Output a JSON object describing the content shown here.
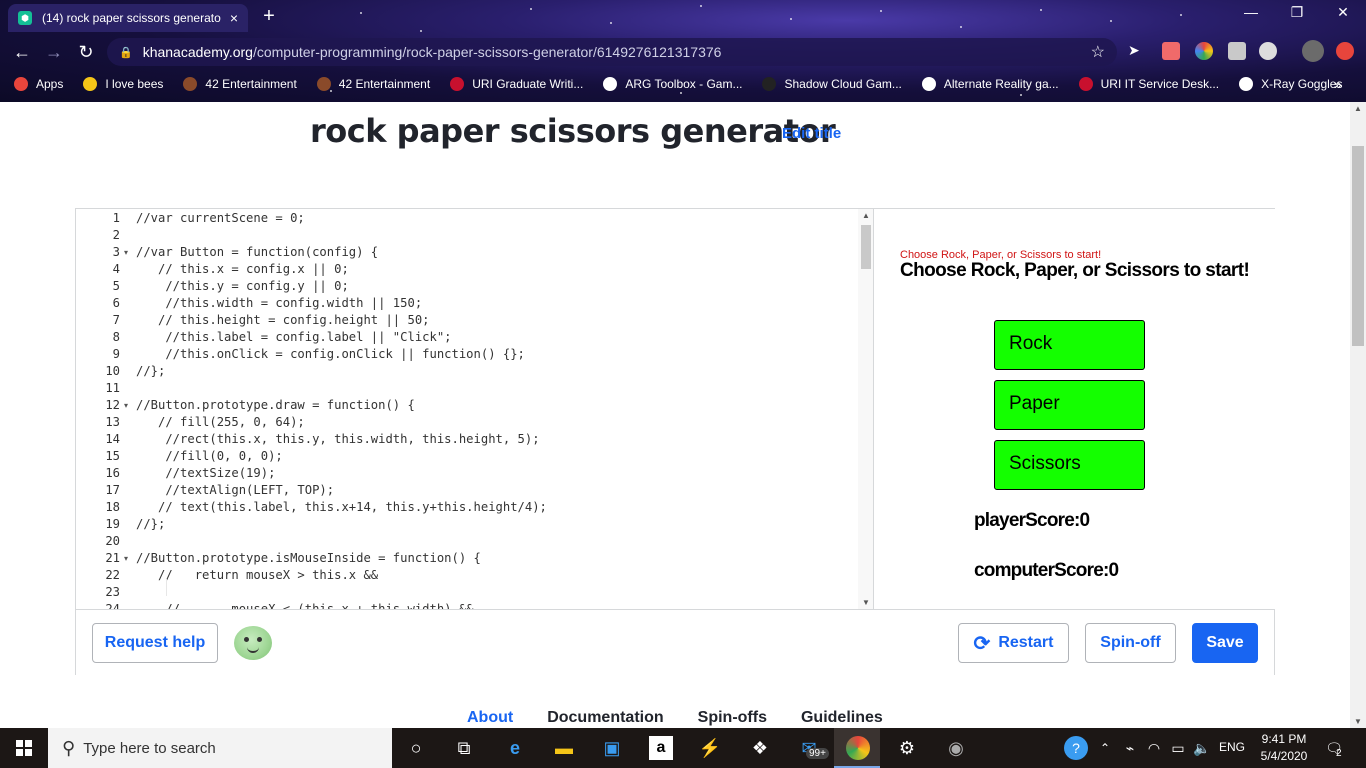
{
  "browser": {
    "tab_title": "(14) rock paper scissors generato",
    "tab_close": "×",
    "new_tab": "+",
    "url_host": "khanacademy.org",
    "url_path": "/computer-programming/rock-paper-scissors-generator/6149276121317376",
    "bookmarks": [
      {
        "label": "Apps",
        "color": "#e8453c"
      },
      {
        "label": "I love bees",
        "color": "#f5c518"
      },
      {
        "label": "42 Entertainment",
        "color": "#8a4a2a"
      },
      {
        "label": "42 Entertainment",
        "color": "#8a4a2a"
      },
      {
        "label": "URI Graduate Writi...",
        "color": "#c8102e"
      },
      {
        "label": "ARG Toolbox - Gam...",
        "color": "#ffffff"
      },
      {
        "label": "Shadow Cloud Gam...",
        "color": "#222222"
      },
      {
        "label": "Alternate Reality ga...",
        "color": "#ffffff"
      },
      {
        "label": "URI IT Service Desk...",
        "color": "#c8102e"
      },
      {
        "label": "X-Ray Goggles",
        "color": "#ffffff"
      }
    ],
    "bookmarks_more": "»"
  },
  "page": {
    "title": "rock paper scissors generator",
    "edit_title": "Edit title"
  },
  "code": {
    "lines": [
      {
        "n": "1",
        "fold": "",
        "text": "//var currentScene = 0;"
      },
      {
        "n": "2",
        "fold": "",
        "text": ""
      },
      {
        "n": "3",
        "fold": "▾",
        "text": "//var Button = function(config) {"
      },
      {
        "n": "4",
        "fold": "",
        "text": "   // this.x = config.x || 0;"
      },
      {
        "n": "5",
        "fold": "",
        "text": "    //this.y = config.y || 0;"
      },
      {
        "n": "6",
        "fold": "",
        "text": "    //this.width = config.width || 150;"
      },
      {
        "n": "7",
        "fold": "",
        "text": "   // this.height = config.height || 50;"
      },
      {
        "n": "8",
        "fold": "",
        "text": "    //this.label = config.label || \"Click\";"
      },
      {
        "n": "9",
        "fold": "",
        "text": "    //this.onClick = config.onClick || function() {};"
      },
      {
        "n": "10",
        "fold": "",
        "text": "//};"
      },
      {
        "n": "11",
        "fold": "",
        "text": ""
      },
      {
        "n": "12",
        "fold": "▾",
        "text": "//Button.prototype.draw = function() {"
      },
      {
        "n": "13",
        "fold": "",
        "text": "   // fill(255, 0, 64);"
      },
      {
        "n": "14",
        "fold": "",
        "text": "    //rect(this.x, this.y, this.width, this.height, 5);"
      },
      {
        "n": "15",
        "fold": "",
        "text": "    //fill(0, 0, 0);"
      },
      {
        "n": "16",
        "fold": "",
        "text": "    //textSize(19);"
      },
      {
        "n": "17",
        "fold": "",
        "text": "    //textAlign(LEFT, TOP);"
      },
      {
        "n": "18",
        "fold": "",
        "text": "   // text(this.label, this.x+14, this.y+this.height/4);"
      },
      {
        "n": "19",
        "fold": "",
        "text": "//};"
      },
      {
        "n": "20",
        "fold": "",
        "text": ""
      },
      {
        "n": "21",
        "fold": "▾",
        "text": "//Button.prototype.isMouseInside = function() {"
      },
      {
        "n": "22",
        "fold": "",
        "text": "   //   return mouseX > this.x &&"
      },
      {
        "n": "23",
        "fold": "",
        "text": ""
      },
      {
        "n": "24",
        "fold": "",
        "text": "    //       mouseX < (this.x + this.width) &&"
      }
    ]
  },
  "output": {
    "small_text": "Choose Rock, Paper, or Scissors to start!",
    "big_text": "Choose Rock, Paper, or Scissors to start!",
    "buttons": [
      "Rock",
      "Paper",
      "Scissors"
    ],
    "player_score": "playerScore:0",
    "computer_score": "computerScore:0",
    "button_color": "#14ff00"
  },
  "actions": {
    "request_help": "Request help",
    "restart": "Restart",
    "spinoff": "Spin-off",
    "save": "Save"
  },
  "footer": {
    "links": [
      "About",
      "Documentation",
      "Spin-offs",
      "Guidelines"
    ]
  },
  "taskbar": {
    "search_placeholder": "Type here to search",
    "lang": "ENG",
    "time": "9:41 PM",
    "date": "5/4/2020",
    "mail_badge": "99+",
    "notif_count": "2"
  },
  "colors": {
    "accent": "#1865f2",
    "title_text": "#21242c",
    "red_text": "#d01414"
  }
}
